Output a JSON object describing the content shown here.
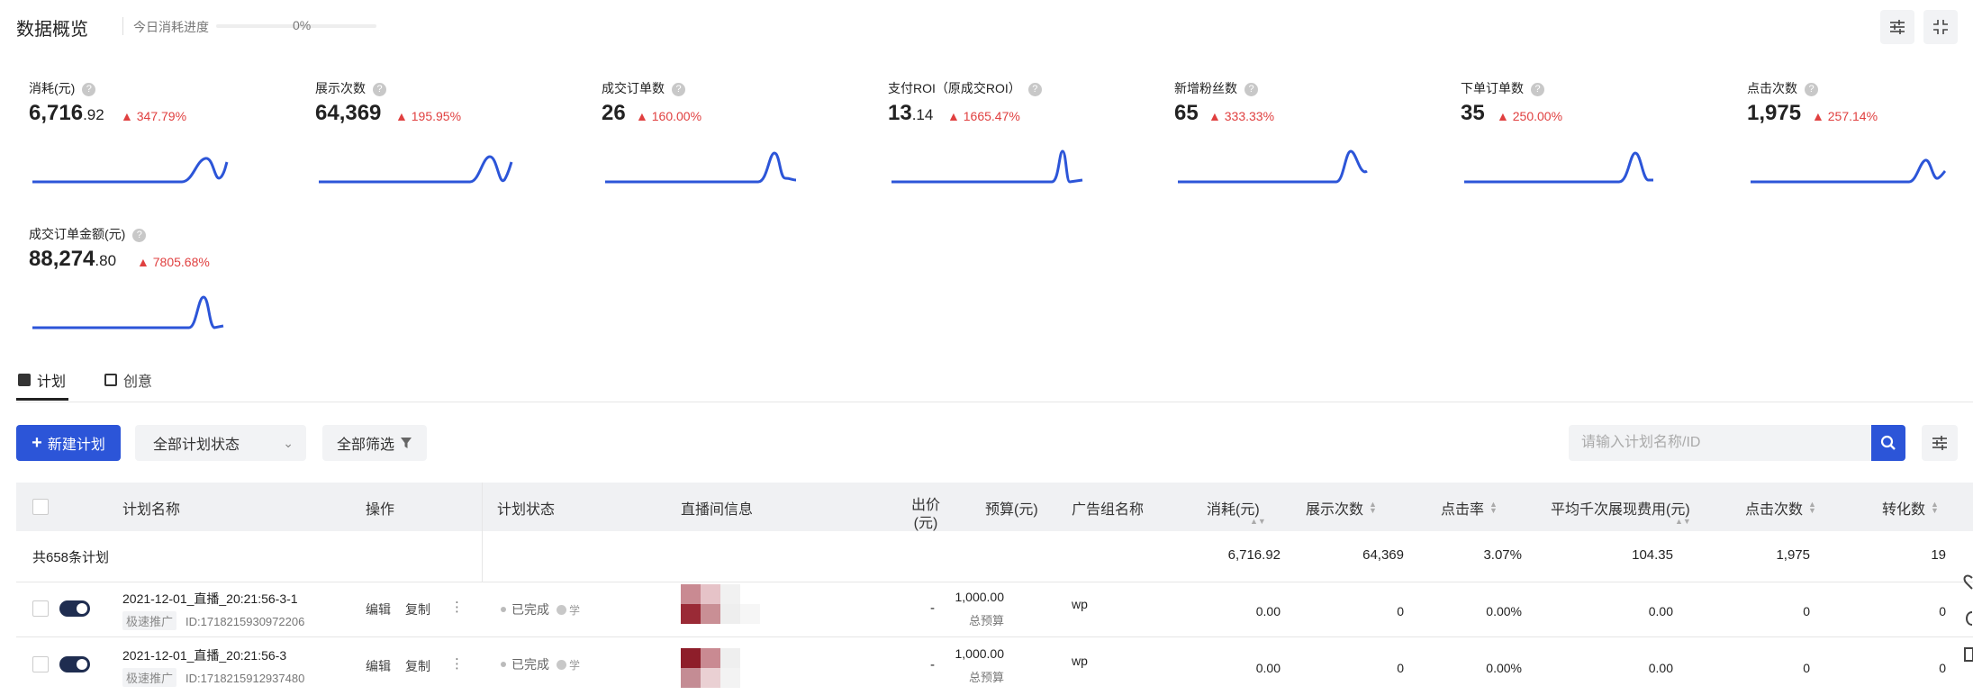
{
  "header": {
    "title": "数据概览",
    "progress_label": "今日消耗进度",
    "progress_value": "0%",
    "progress_fraction": 0.0
  },
  "metrics": [
    {
      "label": "消耗(元)",
      "value_int": "6,716",
      "value_dec": ".92",
      "change": "347.79%"
    },
    {
      "label": "展示次数",
      "value_int": "64,369",
      "value_dec": "",
      "change": "195.95%"
    },
    {
      "label": "成交订单数",
      "value_int": "26",
      "value_dec": "",
      "change": "160.00%"
    },
    {
      "label": "支付ROI（原成交ROI）",
      "value_int": "13",
      "value_dec": ".14",
      "change": "1665.47%"
    },
    {
      "label": "新增粉丝数",
      "value_int": "65",
      "value_dec": "",
      "change": "333.33%"
    },
    {
      "label": "下单订单数",
      "value_int": "35",
      "value_dec": "",
      "change": "250.00%"
    },
    {
      "label": "点击次数",
      "value_int": "1,975",
      "value_dec": "",
      "change": "257.14%"
    },
    {
      "label": "成交订单金额(元)",
      "value_int": "88,274",
      "value_dec": ".80",
      "change": "7805.68%"
    }
  ],
  "tabs": [
    {
      "label": "计划",
      "active": true
    },
    {
      "label": "创意",
      "active": false
    }
  ],
  "toolbar": {
    "new_plan_label": "新建计划",
    "status_select_value": "全部计划状态",
    "filter_label": "全部筛选",
    "search_placeholder": "请输入计划名称/ID"
  },
  "table": {
    "headers": {
      "plan_name": "计划名称",
      "action": "操作",
      "status": "计划状态",
      "live_info": "直播间信息",
      "bid_line1": "出价",
      "bid_line2": "(元)",
      "budget": "预算(元)",
      "ad_group": "广告组名称",
      "cost": "消耗(元)",
      "impressions": "展示次数",
      "ctr": "点击率",
      "cpm": "平均千次展现费用(元)",
      "clicks": "点击次数",
      "conversions": "转化数"
    },
    "summary": {
      "label": "共658条计划",
      "cost": "6,716.92",
      "impressions": "64,369",
      "ctr": "3.07%",
      "cpm": "104.35",
      "clicks": "1,975",
      "conversions": "19"
    },
    "rows": [
      {
        "name": "2021-12-01_直播_20:21:56-3-1",
        "tag": "极速推广",
        "id": "ID:1718215930972206",
        "edit": "编辑",
        "copy": "复制",
        "status": "已完成",
        "status_extra": "学",
        "bid": "-",
        "budget": "1,000.00",
        "budget_note": "总预算",
        "ad_group": "wp",
        "cost": "0.00",
        "impressions": "0",
        "ctr": "0.00%",
        "cpm": "0.00",
        "clicks": "0",
        "conversions": "0"
      },
      {
        "name": "2021-12-01_直播_20:21:56-3",
        "tag": "极速推广",
        "id": "ID:1718215912937480",
        "edit": "编辑",
        "copy": "复制",
        "status": "已完成",
        "status_extra": "学",
        "bid": "-",
        "budget": "1,000.00",
        "budget_note": "总预算",
        "ad_group": "wp",
        "cost": "0.00",
        "impressions": "0",
        "ctr": "0.00%",
        "cpm": "0.00",
        "clicks": "0",
        "conversions": "0"
      }
    ]
  },
  "colors": {
    "accent": "#2c55d8",
    "increase": "#e04040",
    "toggle_on": "#1f2d50"
  }
}
